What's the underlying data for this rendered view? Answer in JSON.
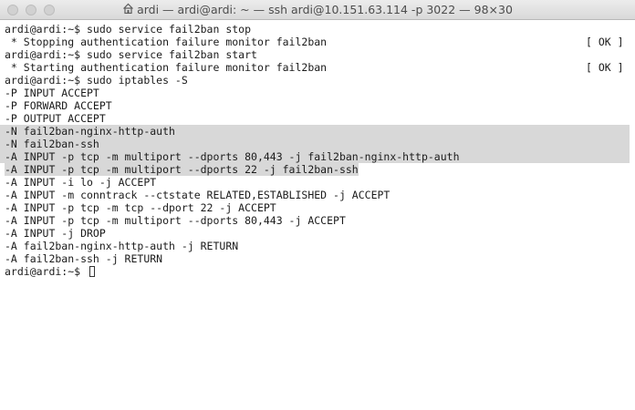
{
  "window": {
    "title": "ardi — ardi@ardi: ~ — ssh ardi@10.151.63.114 -p 3022 — 98×30"
  },
  "colors": {
    "selection": "#d8d8d8",
    "text": "#1b1b1b",
    "background": "#ffffff"
  },
  "terminal": {
    "lines": [
      {
        "text": "ardi@ardi:~$ sudo service fail2ban stop"
      },
      {
        "text": " * Stopping authentication failure monitor fail2ban",
        "status": "[ OK ]"
      },
      {
        "text": "ardi@ardi:~$ sudo service fail2ban start"
      },
      {
        "text": " * Starting authentication failure monitor fail2ban",
        "status": "[ OK ]"
      },
      {
        "text": "ardi@ardi:~$ sudo iptables -S"
      },
      {
        "text": "-P INPUT ACCEPT"
      },
      {
        "text": "-P FORWARD ACCEPT"
      },
      {
        "text": "-P OUTPUT ACCEPT"
      },
      {
        "text": "-N fail2ban-nginx-http-auth",
        "selected": true
      },
      {
        "text": "-N fail2ban-ssh",
        "selected": true
      },
      {
        "text": "-A INPUT -p tcp -m multiport --dports 80,443 -j fail2ban-nginx-http-auth",
        "selected": true
      },
      {
        "text": "-A INPUT -p tcp -m multiport --dports 22 -j fail2ban-ssh",
        "selected_partial": true
      },
      {
        "text": "-A INPUT -i lo -j ACCEPT"
      },
      {
        "text": "-A INPUT -m conntrack --ctstate RELATED,ESTABLISHED -j ACCEPT"
      },
      {
        "text": "-A INPUT -p tcp -m tcp --dport 22 -j ACCEPT"
      },
      {
        "text": "-A INPUT -p tcp -m multiport --dports 80,443 -j ACCEPT"
      },
      {
        "text": "-A INPUT -j DROP"
      },
      {
        "text": "-A fail2ban-nginx-http-auth -j RETURN"
      },
      {
        "text": "-A fail2ban-ssh -j RETURN"
      }
    ],
    "prompt": "ardi@ardi:~$ "
  }
}
